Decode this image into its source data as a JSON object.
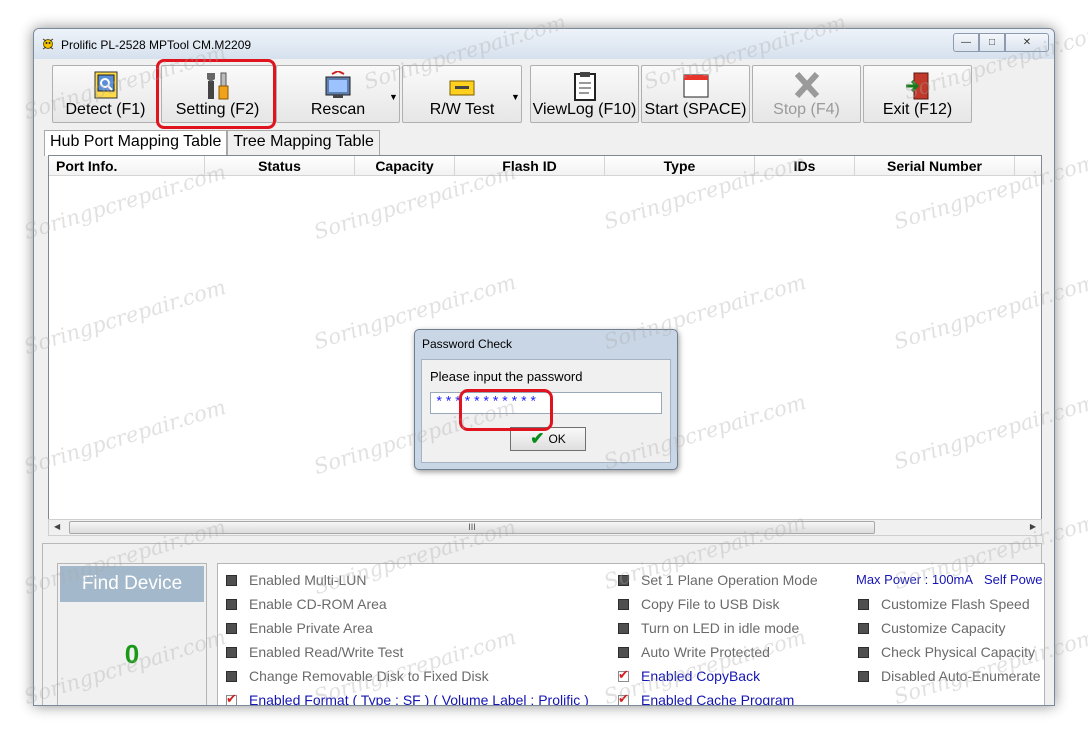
{
  "window": {
    "title": "Prolific PL-2528 MPTool CM.M2209"
  },
  "toolbar": {
    "detect": "Detect (F1)",
    "setting": "Setting (F2)",
    "rescan": "Rescan",
    "rw_test": "R/W Test",
    "viewlog": "ViewLog (F10)",
    "start": "Start (SPACE)",
    "stop": "Stop (F4)",
    "exit": "Exit (F12)"
  },
  "tabs": [
    "Hub Port Mapping Table",
    "Tree Mapping Table"
  ],
  "table": {
    "headers": [
      "Port Info.",
      "Status",
      "Capacity",
      "Flash ID",
      "Type",
      "IDs",
      "Serial Number"
    ]
  },
  "scrollbar": {
    "thumb_grip": "III"
  },
  "find_device": {
    "label": "Find Device",
    "count": "0"
  },
  "options": {
    "col1": [
      {
        "label": "Enabled Multi-LUN",
        "checked": false
      },
      {
        "label": "Enable CD-ROM  Area",
        "checked": false
      },
      {
        "label": "Enable Private Area",
        "checked": false
      },
      {
        "label": "Enabled Read/Write Test",
        "checked": false
      },
      {
        "label": "Change Removable Disk to Fixed Disk",
        "checked": false
      },
      {
        "label": "Enabled Format ( Type : SF )  ( Volume Label : Prolific )",
        "checked": true
      }
    ],
    "col2": [
      {
        "label": "Set 1 Plane Operation Mode",
        "checked": false
      },
      {
        "label": "Copy File to USB Disk",
        "checked": false
      },
      {
        "label": "Turn on LED in idle mode",
        "checked": false
      },
      {
        "label": "Auto  Write Protected",
        "checked": false
      },
      {
        "label": "Enabled CopyBack",
        "checked": true
      },
      {
        "label": "Enabled Cache Program",
        "checked": true
      }
    ],
    "col3": [
      {
        "label": "Customize Flash Speed",
        "checked": false
      },
      {
        "label": "Customize Capacity",
        "checked": false
      },
      {
        "label": "Check Physical Capacity",
        "checked": false
      },
      {
        "label": "Disabled Auto-Enumerate D",
        "checked": false
      }
    ],
    "max_power": "Max Power : 100mA",
    "self_power": "Self Powe"
  },
  "dialog": {
    "title": "Password Check",
    "prompt": "Please input the password",
    "password_value": "***********",
    "ok_label": "OK"
  },
  "watermark": "Soringpcrepair.com",
  "colors": {
    "highlight": "#e0141e",
    "checked_text": "#1414b4",
    "count": "#189a18"
  }
}
